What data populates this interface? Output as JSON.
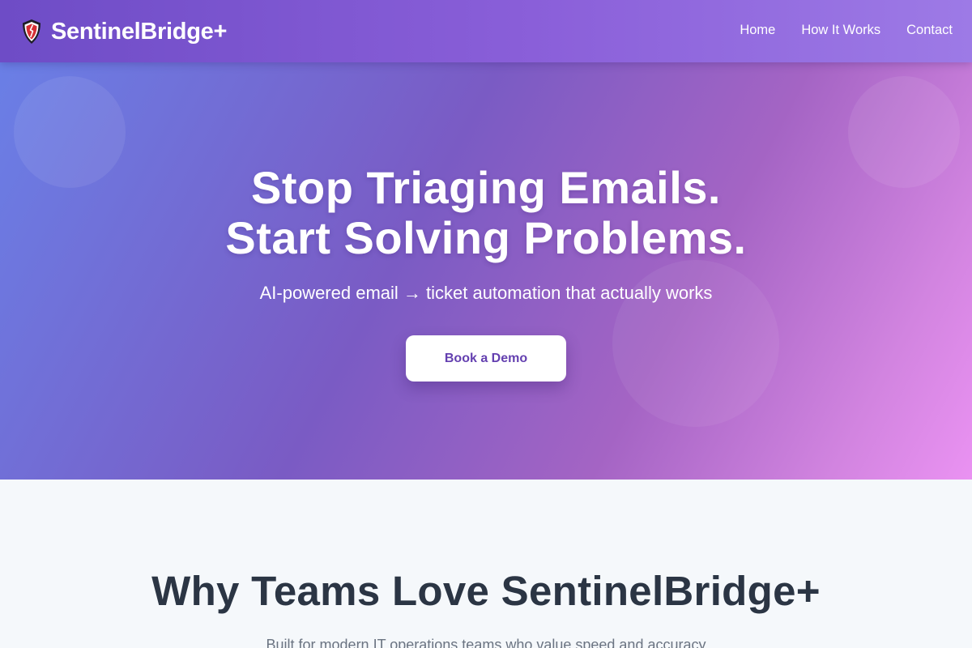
{
  "nav": {
    "brand": "SentinelBridge+",
    "logo_icon": "shield-icon",
    "links": [
      "Home",
      "How It Works",
      "Contact"
    ]
  },
  "hero": {
    "title_line1": "Stop Triaging Emails.",
    "title_line2": "Start Solving Problems.",
    "subtitle": "AI-powered email → ticket automation that actually works",
    "cta_label": "Book a Demo"
  },
  "features": {
    "title": "Why Teams Love SentinelBridge+",
    "subtitle": "Built for modern IT operations teams who value speed and accuracy"
  },
  "colors": {
    "nav_start": "#6e4cc6",
    "nav_end": "#9d7ae6",
    "hero_start": "#6a7fe6",
    "hero_mid": "#7a5bc4",
    "hero_end": "#ea92f2",
    "cta_text": "#6440b0",
    "section_bg": "#f5f8fb",
    "heading_dark": "#2b3544",
    "logo_red": "#d62f35"
  }
}
